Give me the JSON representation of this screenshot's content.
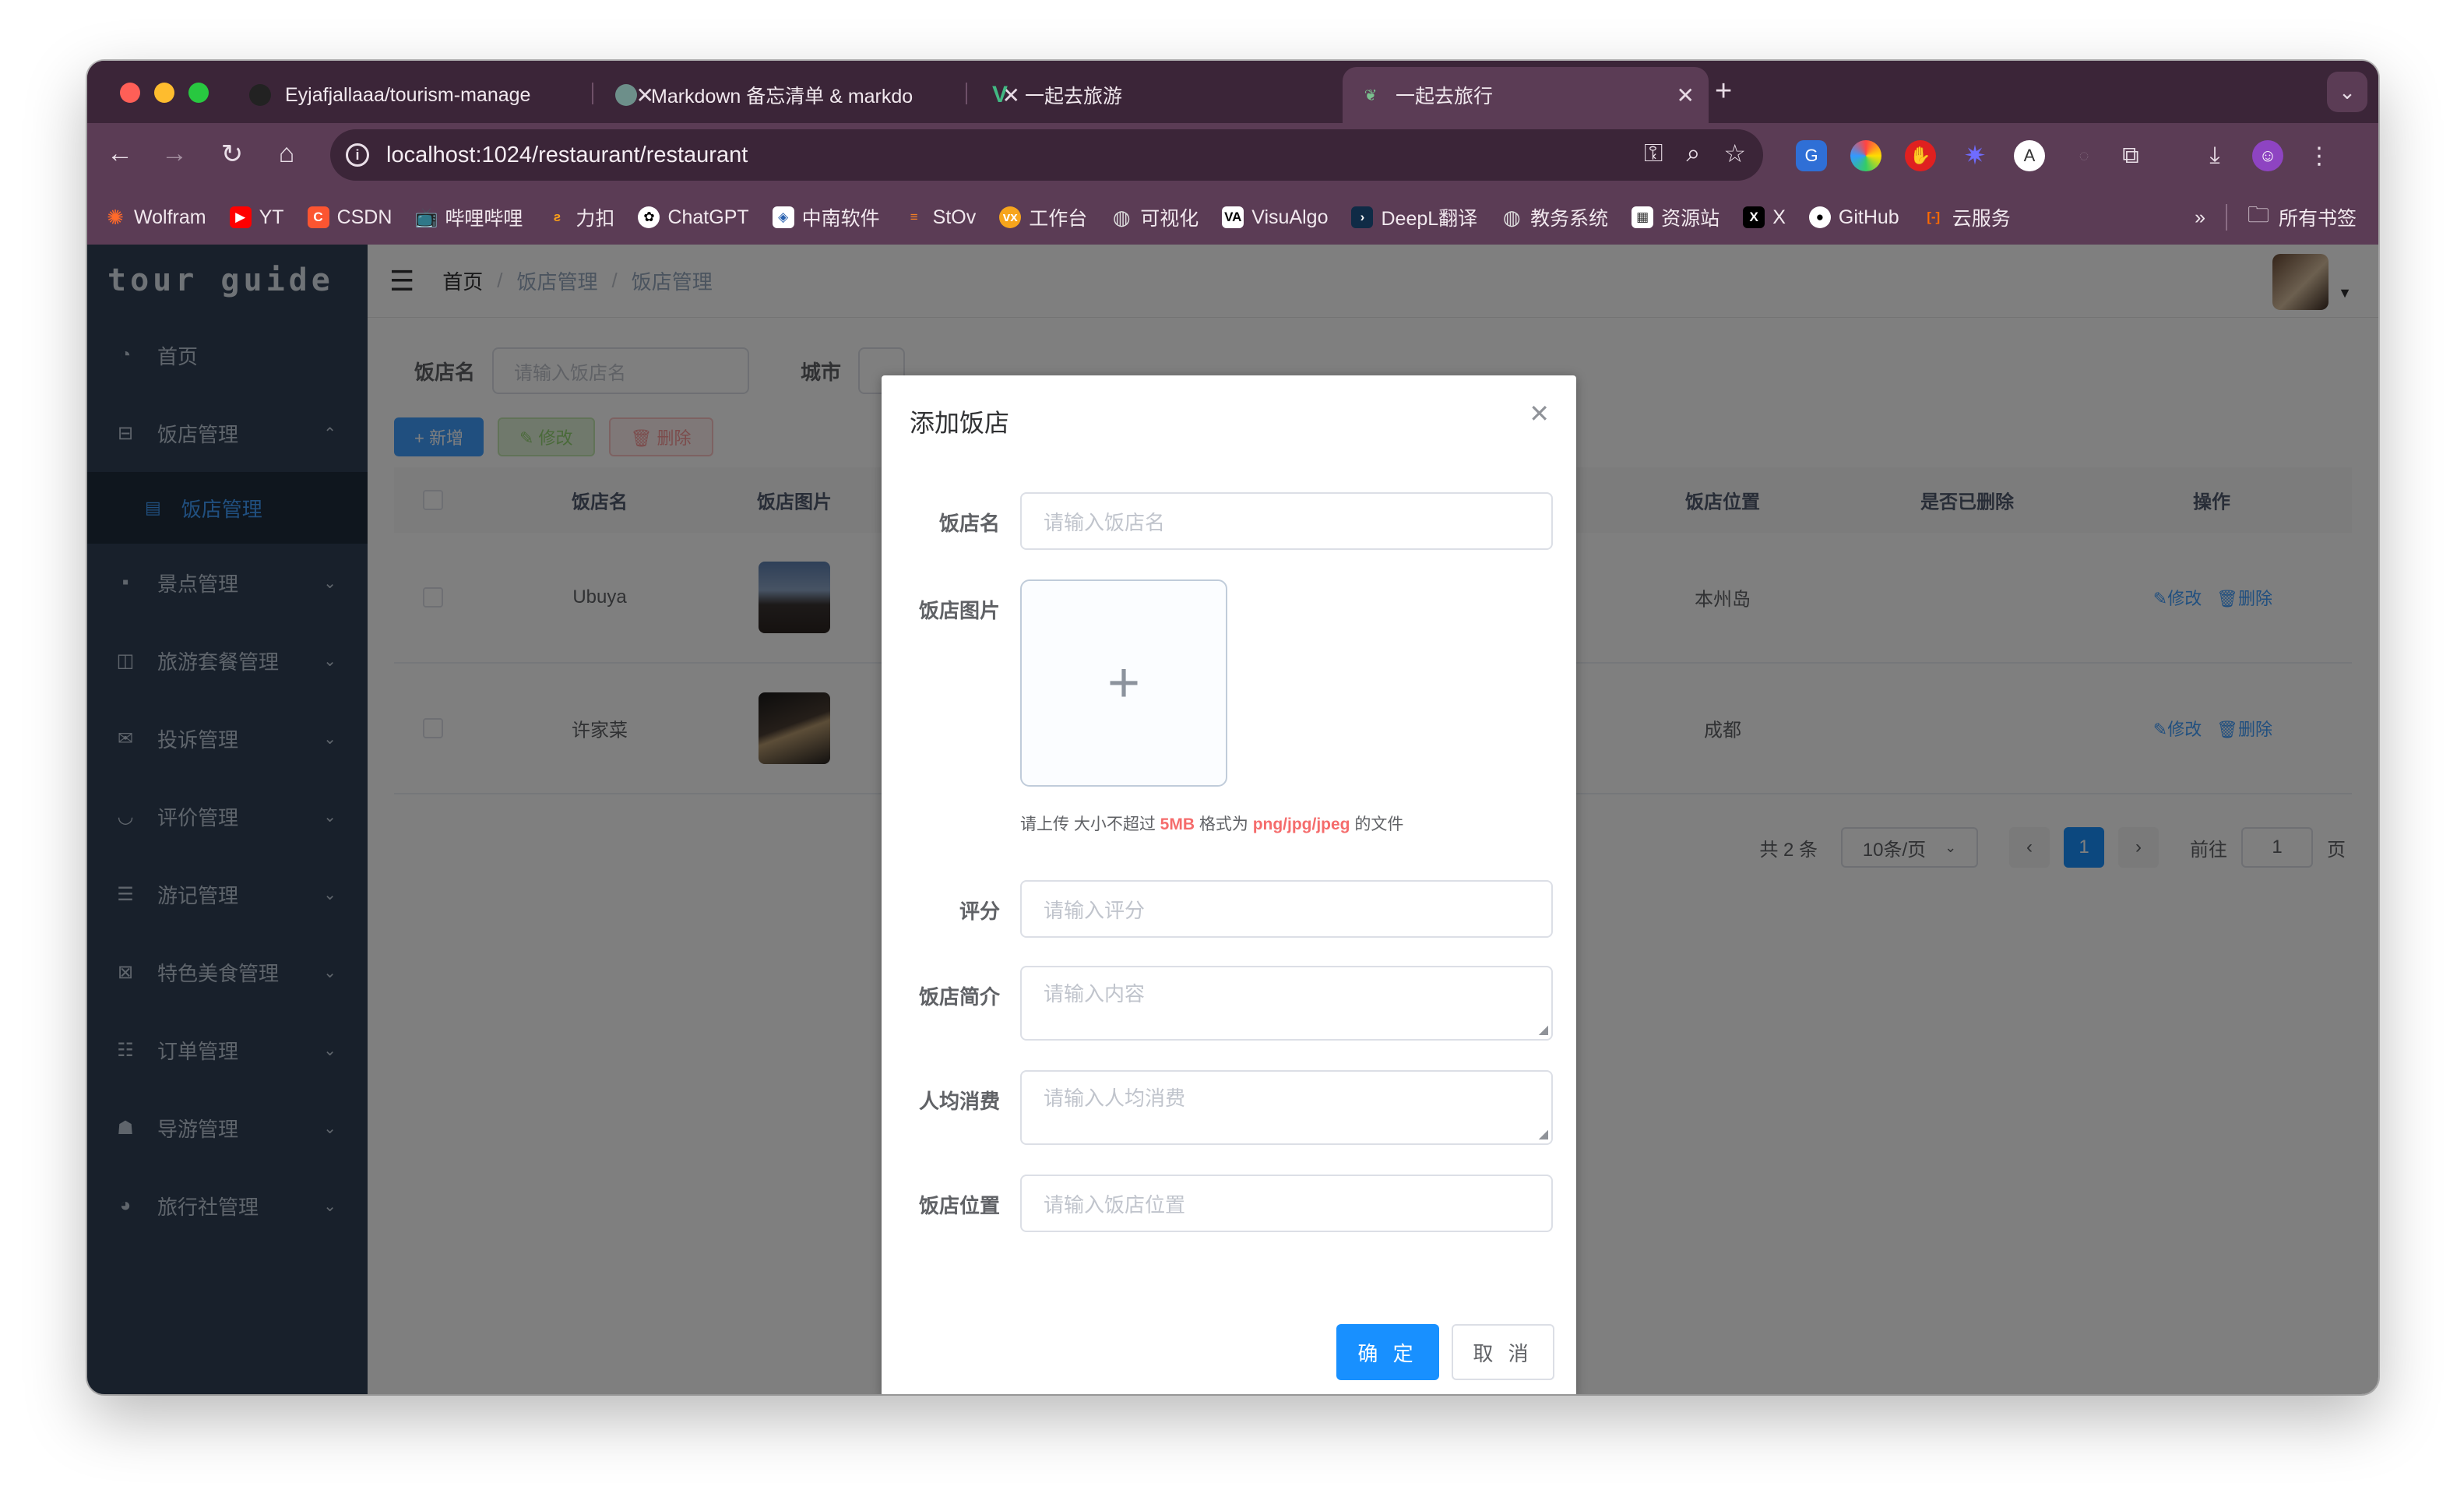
{
  "browser": {
    "tabs": [
      {
        "title": "Eyjafjallaaa/tourism-manage"
      },
      {
        "title": "Markdown 备忘清单 & markdo"
      },
      {
        "title": "一起去旅游"
      },
      {
        "title": "一起去旅行"
      }
    ],
    "url": "localhost:1024/restaurant/restaurant",
    "bookmarks": [
      "Wolfram",
      "YT",
      "CSDN",
      "哔哩哔哩",
      "力扣",
      "ChatGPT",
      "中南软件",
      "StOv",
      "工作台",
      "可视化",
      "VisuAlgo",
      "DeepL翻译",
      "教务系统",
      "资源站",
      "X",
      "GitHub",
      "云服务"
    ],
    "bookmarks_folder": "所有书签",
    "more": "»"
  },
  "app": {
    "logo": "tour guide",
    "menu": [
      {
        "label": "首页",
        "icon": "dashboard-icon"
      },
      {
        "label": "饭店管理",
        "icon": "restaurant-icon",
        "open": true
      },
      {
        "label": "景点管理",
        "icon": "chat-icon"
      },
      {
        "label": "旅游套餐管理",
        "icon": "book-icon"
      },
      {
        "label": "投诉管理",
        "icon": "mail-icon"
      },
      {
        "label": "评价管理",
        "icon": "eye-icon"
      },
      {
        "label": "游记管理",
        "icon": "list-icon"
      },
      {
        "label": "特色美食管理",
        "icon": "picture-icon"
      },
      {
        "label": "订单管理",
        "icon": "order-icon"
      },
      {
        "label": "导游管理",
        "icon": "people-icon"
      },
      {
        "label": "旅行社管理",
        "icon": "globe-icon"
      }
    ],
    "submenu": {
      "label": "饭店管理"
    },
    "breadcrumb": [
      "首页",
      "饭店管理",
      "饭店管理"
    ],
    "filter": {
      "name_label": "饭店名",
      "name_placeholder": "请输入饭店名",
      "city_label": "城市"
    },
    "buttons": {
      "add": "+ 新增",
      "edit": "✎ 修改",
      "delete": "🗑 删除"
    },
    "table": {
      "headers": {
        "name": "饭店名",
        "image": "饭店图片",
        "location": "饭店位置",
        "deleted": "是否已删除",
        "ops": "操作"
      },
      "rows": [
        {
          "name": "Ubuya",
          "location": "本州岛",
          "edit": "✎修改",
          "delete": "🗑删除"
        },
        {
          "name": "许家菜",
          "location": "成都",
          "edit": "✎修改",
          "delete": "🗑删除"
        }
      ]
    },
    "pagination": {
      "total": "共 2 条",
      "page_size": "10条/页",
      "current": "1",
      "goto": "前往",
      "goto_value": "1",
      "page_unit": "页"
    }
  },
  "dialog": {
    "title": "添加饭店",
    "fields": {
      "name": {
        "label": "饭店名",
        "placeholder": "请输入饭店名"
      },
      "image": {
        "label": "饭店图片"
      },
      "score": {
        "label": "评分",
        "placeholder": "请输入评分"
      },
      "intro": {
        "label": "饭店简介",
        "placeholder": "请输入内容"
      },
      "avg": {
        "label": "人均消费",
        "placeholder": "请输入人均消费"
      },
      "location": {
        "label": "饭店位置",
        "placeholder": "请输入饭店位置"
      }
    },
    "upload_tip": {
      "prefix": "请上传 大小不超过 ",
      "size": "5MB",
      "mid": " 格式为 ",
      "formats": "png/jpg/jpeg",
      "suffix": " 的文件"
    },
    "confirm": "确 定",
    "cancel": "取 消"
  },
  "colors": {
    "primary": "#1890ff",
    "sidebar": "#304156",
    "warn": "#f56c6c"
  }
}
